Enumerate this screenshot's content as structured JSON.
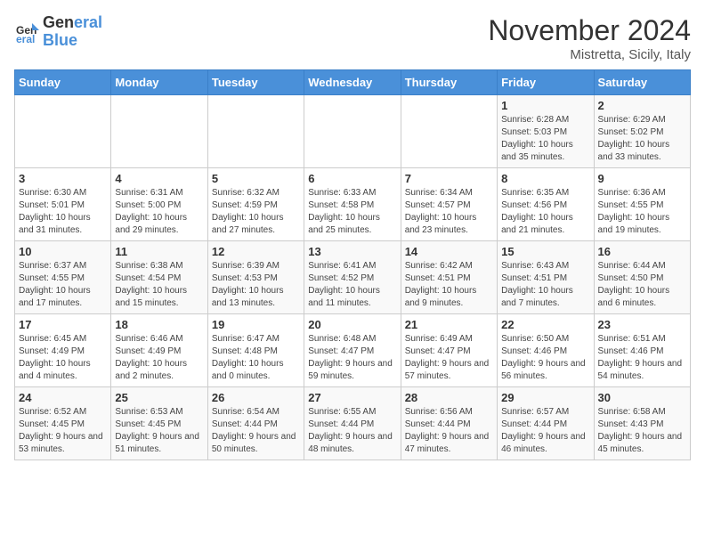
{
  "logo": {
    "line1": "General",
    "line2": "Blue"
  },
  "title": "November 2024",
  "subtitle": "Mistretta, Sicily, Italy",
  "days_of_week": [
    "Sunday",
    "Monday",
    "Tuesday",
    "Wednesday",
    "Thursday",
    "Friday",
    "Saturday"
  ],
  "weeks": [
    [
      {
        "day": "",
        "info": ""
      },
      {
        "day": "",
        "info": ""
      },
      {
        "day": "",
        "info": ""
      },
      {
        "day": "",
        "info": ""
      },
      {
        "day": "",
        "info": ""
      },
      {
        "day": "1",
        "info": "Sunrise: 6:28 AM\nSunset: 5:03 PM\nDaylight: 10 hours and 35 minutes."
      },
      {
        "day": "2",
        "info": "Sunrise: 6:29 AM\nSunset: 5:02 PM\nDaylight: 10 hours and 33 minutes."
      }
    ],
    [
      {
        "day": "3",
        "info": "Sunrise: 6:30 AM\nSunset: 5:01 PM\nDaylight: 10 hours and 31 minutes."
      },
      {
        "day": "4",
        "info": "Sunrise: 6:31 AM\nSunset: 5:00 PM\nDaylight: 10 hours and 29 minutes."
      },
      {
        "day": "5",
        "info": "Sunrise: 6:32 AM\nSunset: 4:59 PM\nDaylight: 10 hours and 27 minutes."
      },
      {
        "day": "6",
        "info": "Sunrise: 6:33 AM\nSunset: 4:58 PM\nDaylight: 10 hours and 25 minutes."
      },
      {
        "day": "7",
        "info": "Sunrise: 6:34 AM\nSunset: 4:57 PM\nDaylight: 10 hours and 23 minutes."
      },
      {
        "day": "8",
        "info": "Sunrise: 6:35 AM\nSunset: 4:56 PM\nDaylight: 10 hours and 21 minutes."
      },
      {
        "day": "9",
        "info": "Sunrise: 6:36 AM\nSunset: 4:55 PM\nDaylight: 10 hours and 19 minutes."
      }
    ],
    [
      {
        "day": "10",
        "info": "Sunrise: 6:37 AM\nSunset: 4:55 PM\nDaylight: 10 hours and 17 minutes."
      },
      {
        "day": "11",
        "info": "Sunrise: 6:38 AM\nSunset: 4:54 PM\nDaylight: 10 hours and 15 minutes."
      },
      {
        "day": "12",
        "info": "Sunrise: 6:39 AM\nSunset: 4:53 PM\nDaylight: 10 hours and 13 minutes."
      },
      {
        "day": "13",
        "info": "Sunrise: 6:41 AM\nSunset: 4:52 PM\nDaylight: 10 hours and 11 minutes."
      },
      {
        "day": "14",
        "info": "Sunrise: 6:42 AM\nSunset: 4:51 PM\nDaylight: 10 hours and 9 minutes."
      },
      {
        "day": "15",
        "info": "Sunrise: 6:43 AM\nSunset: 4:51 PM\nDaylight: 10 hours and 7 minutes."
      },
      {
        "day": "16",
        "info": "Sunrise: 6:44 AM\nSunset: 4:50 PM\nDaylight: 10 hours and 6 minutes."
      }
    ],
    [
      {
        "day": "17",
        "info": "Sunrise: 6:45 AM\nSunset: 4:49 PM\nDaylight: 10 hours and 4 minutes."
      },
      {
        "day": "18",
        "info": "Sunrise: 6:46 AM\nSunset: 4:49 PM\nDaylight: 10 hours and 2 minutes."
      },
      {
        "day": "19",
        "info": "Sunrise: 6:47 AM\nSunset: 4:48 PM\nDaylight: 10 hours and 0 minutes."
      },
      {
        "day": "20",
        "info": "Sunrise: 6:48 AM\nSunset: 4:47 PM\nDaylight: 9 hours and 59 minutes."
      },
      {
        "day": "21",
        "info": "Sunrise: 6:49 AM\nSunset: 4:47 PM\nDaylight: 9 hours and 57 minutes."
      },
      {
        "day": "22",
        "info": "Sunrise: 6:50 AM\nSunset: 4:46 PM\nDaylight: 9 hours and 56 minutes."
      },
      {
        "day": "23",
        "info": "Sunrise: 6:51 AM\nSunset: 4:46 PM\nDaylight: 9 hours and 54 minutes."
      }
    ],
    [
      {
        "day": "24",
        "info": "Sunrise: 6:52 AM\nSunset: 4:45 PM\nDaylight: 9 hours and 53 minutes."
      },
      {
        "day": "25",
        "info": "Sunrise: 6:53 AM\nSunset: 4:45 PM\nDaylight: 9 hours and 51 minutes."
      },
      {
        "day": "26",
        "info": "Sunrise: 6:54 AM\nSunset: 4:44 PM\nDaylight: 9 hours and 50 minutes."
      },
      {
        "day": "27",
        "info": "Sunrise: 6:55 AM\nSunset: 4:44 PM\nDaylight: 9 hours and 48 minutes."
      },
      {
        "day": "28",
        "info": "Sunrise: 6:56 AM\nSunset: 4:44 PM\nDaylight: 9 hours and 47 minutes."
      },
      {
        "day": "29",
        "info": "Sunrise: 6:57 AM\nSunset: 4:44 PM\nDaylight: 9 hours and 46 minutes."
      },
      {
        "day": "30",
        "info": "Sunrise: 6:58 AM\nSunset: 4:43 PM\nDaylight: 9 hours and 45 minutes."
      }
    ]
  ]
}
